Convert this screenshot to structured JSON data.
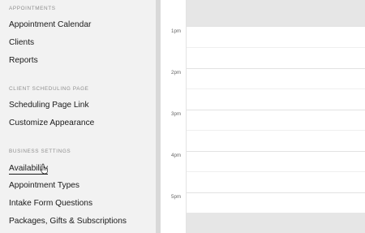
{
  "sidebar": {
    "sections": [
      {
        "label": "APPOINTMENTS",
        "items": [
          "Appointment Calendar",
          "Clients",
          "Reports"
        ]
      },
      {
        "label": "CLIENT SCHEDULING PAGE",
        "items": [
          "Scheduling Page Link",
          "Customize Appearance"
        ]
      },
      {
        "label": "BUSINESS SETTINGS",
        "items": [
          "Availability",
          "Appointment Types",
          "Intake Form Questions",
          "Packages, Gifts & Subscriptions"
        ]
      }
    ],
    "active_item": "Availability"
  },
  "calendar": {
    "times": [
      "1pm",
      "2pm",
      "3pm",
      "4pm",
      "5pm"
    ]
  }
}
